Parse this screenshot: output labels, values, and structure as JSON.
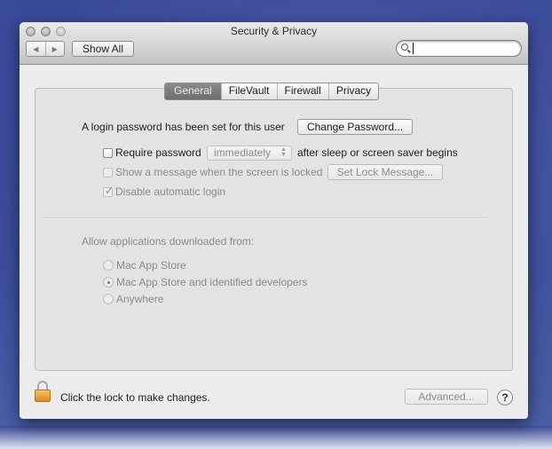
{
  "window": {
    "title": "Security & Privacy",
    "back_icon": "◀",
    "forward_icon": "▶",
    "show_all_label": "Show All",
    "search": {
      "value": "",
      "placeholder": ""
    }
  },
  "tabs": [
    {
      "label": "General",
      "active": true
    },
    {
      "label": "FileVault",
      "active": false
    },
    {
      "label": "Firewall",
      "active": false
    },
    {
      "label": "Privacy",
      "active": false
    }
  ],
  "general": {
    "login_password_text": "A login password has been set for this user",
    "change_password_label": "Change Password...",
    "require_password": {
      "label": "Require password",
      "checked": false,
      "select_value": "immediately",
      "suffix": "after sleep or screen saver begins"
    },
    "show_message": {
      "label": "Show a message when the screen is locked",
      "checked": false,
      "enabled": false,
      "button_label": "Set Lock Message..."
    },
    "disable_auto_login": {
      "label": "Disable automatic login",
      "checked": true,
      "enabled": false
    },
    "allow_apps": {
      "heading": "Allow applications downloaded from:",
      "options": [
        {
          "label": "Mac App Store",
          "selected": false
        },
        {
          "label": "Mac App Store and identified developers",
          "selected": true
        },
        {
          "label": "Anywhere",
          "selected": false
        }
      ]
    }
  },
  "footer": {
    "lock_text": "Click the lock to make changes.",
    "advanced_label": "Advanced...",
    "help_label": "?"
  }
}
